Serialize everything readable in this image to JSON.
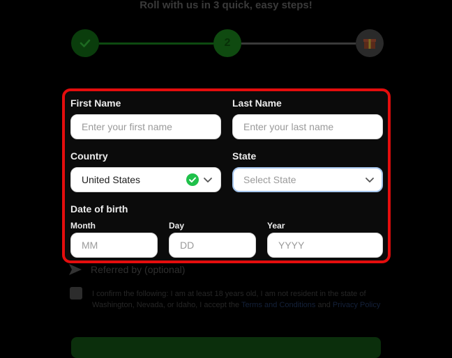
{
  "header": {
    "subtitle": "Roll with us in 3 quick, easy steps!",
    "step2_label": "2"
  },
  "form": {
    "first_name": {
      "label": "First Name",
      "placeholder": "Enter your first name"
    },
    "last_name": {
      "label": "Last Name",
      "placeholder": "Enter your last name"
    },
    "country": {
      "label": "Country",
      "value": "United States"
    },
    "state": {
      "label": "State",
      "placeholder": "Select State"
    },
    "dob": {
      "label": "Date of birth",
      "month": {
        "label": "Month",
        "placeholder": "MM"
      },
      "day": {
        "label": "Day",
        "placeholder": "DD"
      },
      "year": {
        "label": "Year",
        "placeholder": "YYYY"
      }
    }
  },
  "referral": {
    "label": "Referred by (optional)"
  },
  "confirm": {
    "text": "I confirm the following: I am at least 18 years old, I am not resident in the state of Washington, Nevada, or Idaho, I accept the",
    "terms_link": "Terms and Conditions",
    "and": "and",
    "privacy_link": "Privacy Policy"
  },
  "colors": {
    "highlight_border": "#e40d0d",
    "success_green": "#1fc14a",
    "state_focus_border": "#a8c8ef"
  }
}
